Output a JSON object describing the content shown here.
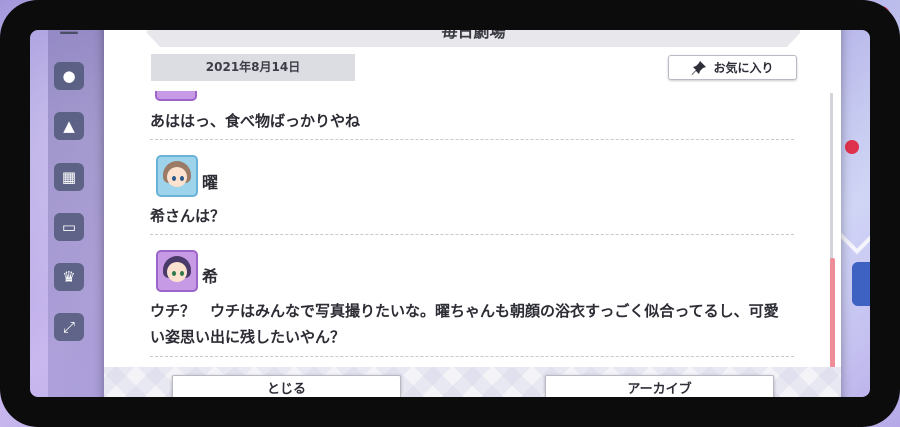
{
  "modal": {
    "title": "毎日劇場",
    "date": "2021年8月14日",
    "favorite_label": "お気に入り"
  },
  "dialogue": [
    {
      "speaker": "",
      "text": "あははっ、食べ物ばっかりやね"
    },
    {
      "speaker": "曜",
      "text": "希さんは？"
    },
    {
      "speaker": "希",
      "text": "ウチ？　ウチはみんなで写真撮りたいな。曜ちゃんも朝顔の浴衣すっごく似合ってるし、可愛い姿思い出に残したいやん？"
    }
  ],
  "footer": {
    "close_label": "とじる",
    "archive_label": "アーカイブ"
  },
  "colors": {
    "accent_scroll": "#ee8c98",
    "speaker_you_frame": "#6bb2d9",
    "speaker_nozomi_frame": "#9d64c9"
  },
  "icons": [
    "menu-icon",
    "pin-icon",
    "notification-badge-icon"
  ]
}
